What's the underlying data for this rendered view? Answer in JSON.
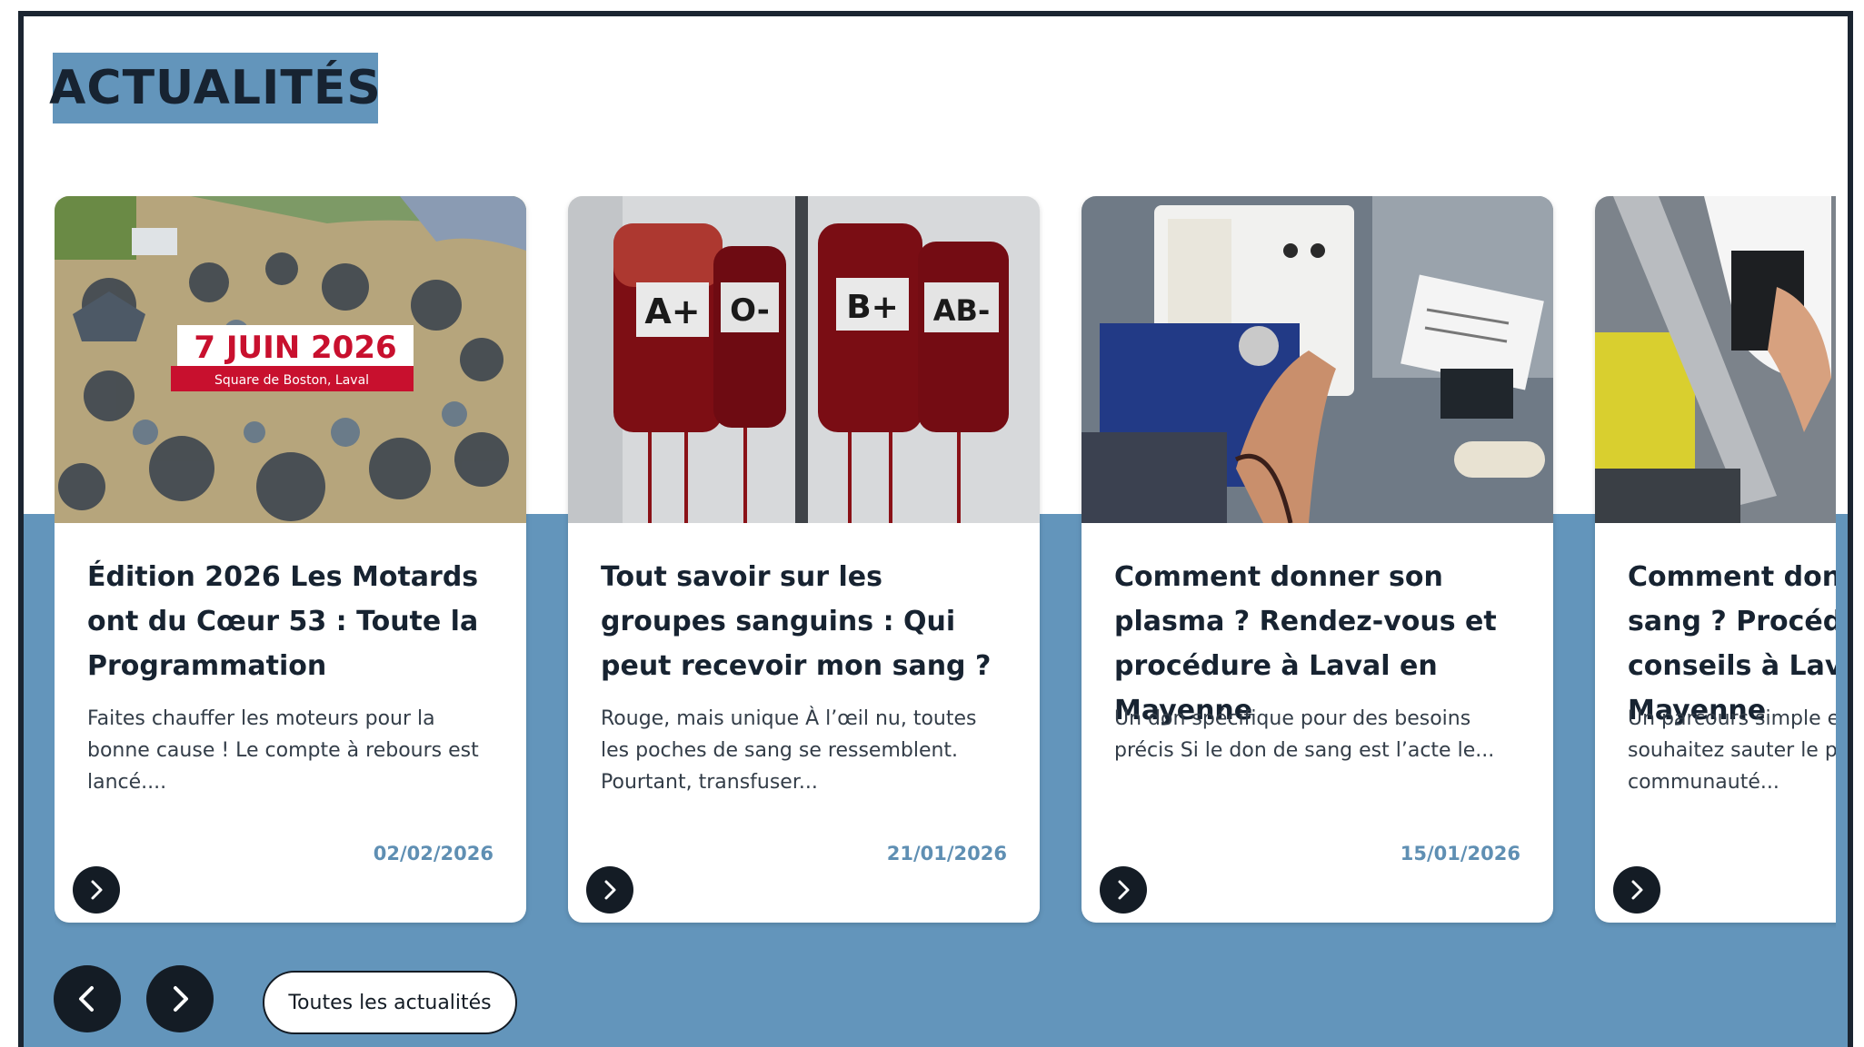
{
  "section": {
    "title": "ACTUALITÉS"
  },
  "cards": [
    {
      "title": "Édition 2026 Les Motards ont du Cœur 53 : Toute la Programmation",
      "excerpt": "Faites chauffer les moteurs pour la bonne cause ! Le compte à rebours est lancé....",
      "date": "02/02/2026",
      "image_banner_date": "7 JUIN 2026",
      "image_banner_place": "Square de Boston, Laval"
    },
    {
      "title": "Tout savoir sur les groupes sanguins : Qui peut recevoir mon sang ?",
      "excerpt": "Rouge, mais unique À l’œil nu, toutes les poches de sang se ressemblent. Pourtant, transfuser...",
      "date": "21/01/2026",
      "image_labels": [
        "A+",
        "O-",
        "B+",
        "AB-"
      ]
    },
    {
      "title": "Comment donner son plasma ? Rendez-vous et procédure à Laval en Mayenne",
      "excerpt": "Un don spécifique pour des besoins précis Si le don de sang est l’acte le...",
      "date": "15/01/2026"
    },
    {
      "title": "Comment donner son sang ? Procédure, conseils à Laval en Mayenne",
      "excerpt": "Un parcours simple et convivial Vous souhaitez sauter le pas et rejoindre la communauté..."
    }
  ],
  "controls": {
    "prev_icon": "chevron-left-icon",
    "next_icon": "chevron-right-icon",
    "card_arrow_icon": "chevron-right-icon",
    "all_news_label": "Toutes les actualités"
  },
  "colors": {
    "frame": "#1b2531",
    "accent_blue": "#6395bb",
    "dark": "#141c25",
    "date_blue": "#5f8fb3",
    "banner_red": "#c8102e"
  }
}
